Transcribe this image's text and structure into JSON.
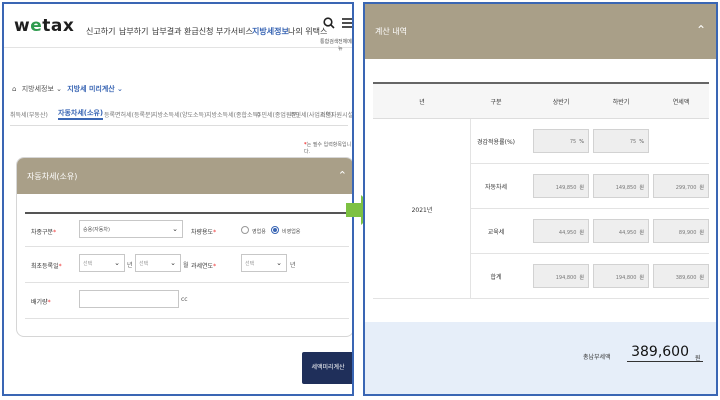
{
  "logo": {
    "text_we": "w",
    "text_o": "e",
    "text_tax": "tax"
  },
  "nav": {
    "items": [
      "신고하기",
      "납부하기",
      "납부결과",
      "환급신청",
      "부가서비스",
      "지방세정보",
      "나의 위택스"
    ],
    "active_index": 5,
    "search_label": "통합검색",
    "menu_label": "전체메뉴"
  },
  "breadcrumb": {
    "home_icon": "home-icon",
    "parent": "지방세정보",
    "current": "지방세 미리계산"
  },
  "subtabs": {
    "items": [
      "취득세(부동산)",
      "자동차세(소유)",
      "등록면허세(등록분)",
      "지방소득세(양도소득)",
      "지방소득세(종합소득)",
      "주민세(종업원분)",
      "주민세(사업소분)",
      "지역자원시설세"
    ],
    "selected_index": 1
  },
  "required_note": {
    "mark": "*",
    "text": "는 필수 입력항목입니다."
  },
  "form": {
    "title": "자동차세(소유)",
    "collapse_icon": "chevron-up-icon",
    "car_type_label": "차종구분",
    "car_type_value": "승용(자동차)",
    "use_label": "차량용도",
    "use_option_a": "영업용",
    "use_option_b": "비영업용",
    "use_selected": "비영업용",
    "reg_date_label": "최초등록일",
    "year_placeholder": "선택",
    "year_unit": "년",
    "month_placeholder": "선택",
    "month_unit": "월",
    "tax_year_label": "과세연도",
    "tax_year_placeholder": "선택",
    "tax_year_unit": "년",
    "cc_label": "배기량",
    "cc_value": "",
    "cc_unit": "cc",
    "required_mark": "*"
  },
  "calc_button": "세액미리계산",
  "result": {
    "title": "계산 내역",
    "collapse_icon": "chevron-up-icon",
    "columns": [
      "년",
      "구분",
      "상반기",
      "하반기",
      "연세액"
    ],
    "year": "2021년",
    "rows": [
      {
        "label": "경감적용률(%)",
        "first": "75",
        "second": "75",
        "annual": "",
        "unit": "%"
      },
      {
        "label": "자동차세",
        "first": "149,850",
        "second": "149,850",
        "annual": "299,700",
        "unit": "원"
      },
      {
        "label": "교육세",
        "first": "44,950",
        "second": "44,950",
        "annual": "89,900",
        "unit": "원"
      },
      {
        "label": "합계",
        "first": "194,800",
        "second": "194,800",
        "annual": "389,600",
        "unit": "원"
      }
    ],
    "total_label": "총납부세액",
    "total_value": "389,600",
    "total_unit": "원"
  },
  "arrow_color": "#7dc142",
  "header_color": "#a99f88",
  "accent_color": "#3a66b4"
}
